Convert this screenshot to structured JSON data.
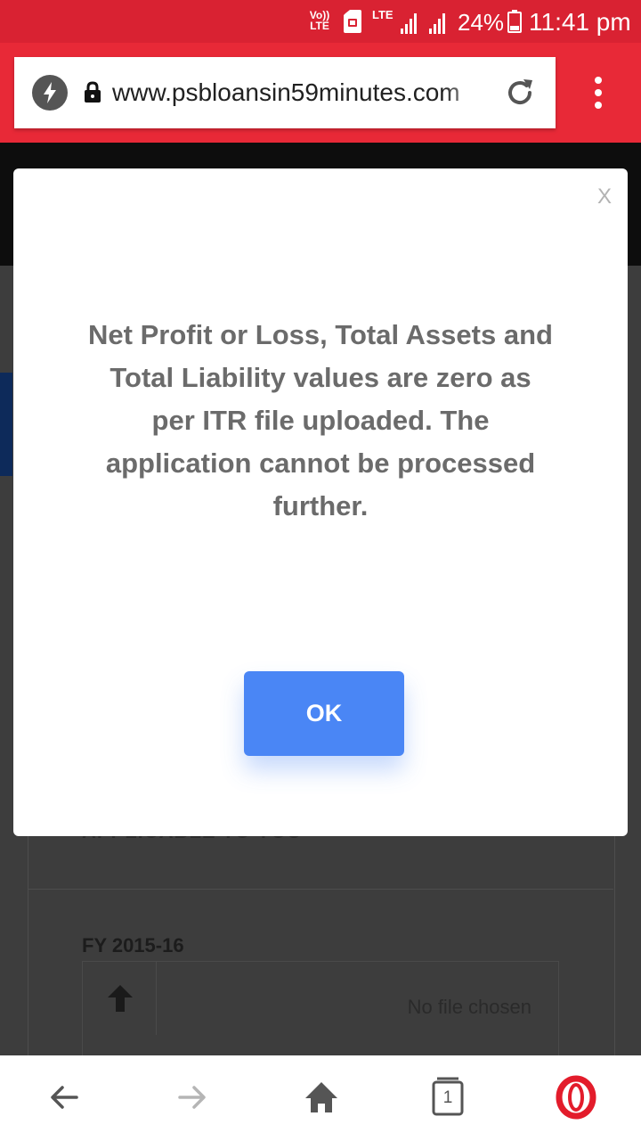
{
  "status_bar": {
    "volte_top": "Vo))",
    "volte_bottom": "LTE",
    "network": "LTE",
    "battery_percent": "24%",
    "time": "11:41 pm",
    "background_color": "#d92232"
  },
  "browser": {
    "url": "www.psbloansin59minutes.com",
    "toolbar_color": "#e82937",
    "icons": [
      "turbo-icon",
      "lock-icon",
      "reload-icon",
      "menu-icon"
    ]
  },
  "page": {
    "hidden_heading": "APPLICABLE TO YOU",
    "fy_label": "FY 2015-16",
    "file_status": "No file chosen"
  },
  "modal": {
    "close_label": "X",
    "message": "Net Profit or Loss, Total Assets and Total Liability values are zero as per ITR file uploaded. The application cannot be processed further.",
    "ok_label": "OK",
    "ok_color": "#4a86f5"
  },
  "bottom_nav": {
    "tab_count": "1",
    "icons": [
      "back-arrow-icon",
      "forward-arrow-icon",
      "home-icon",
      "tabs-icon",
      "opera-logo-icon"
    ]
  }
}
